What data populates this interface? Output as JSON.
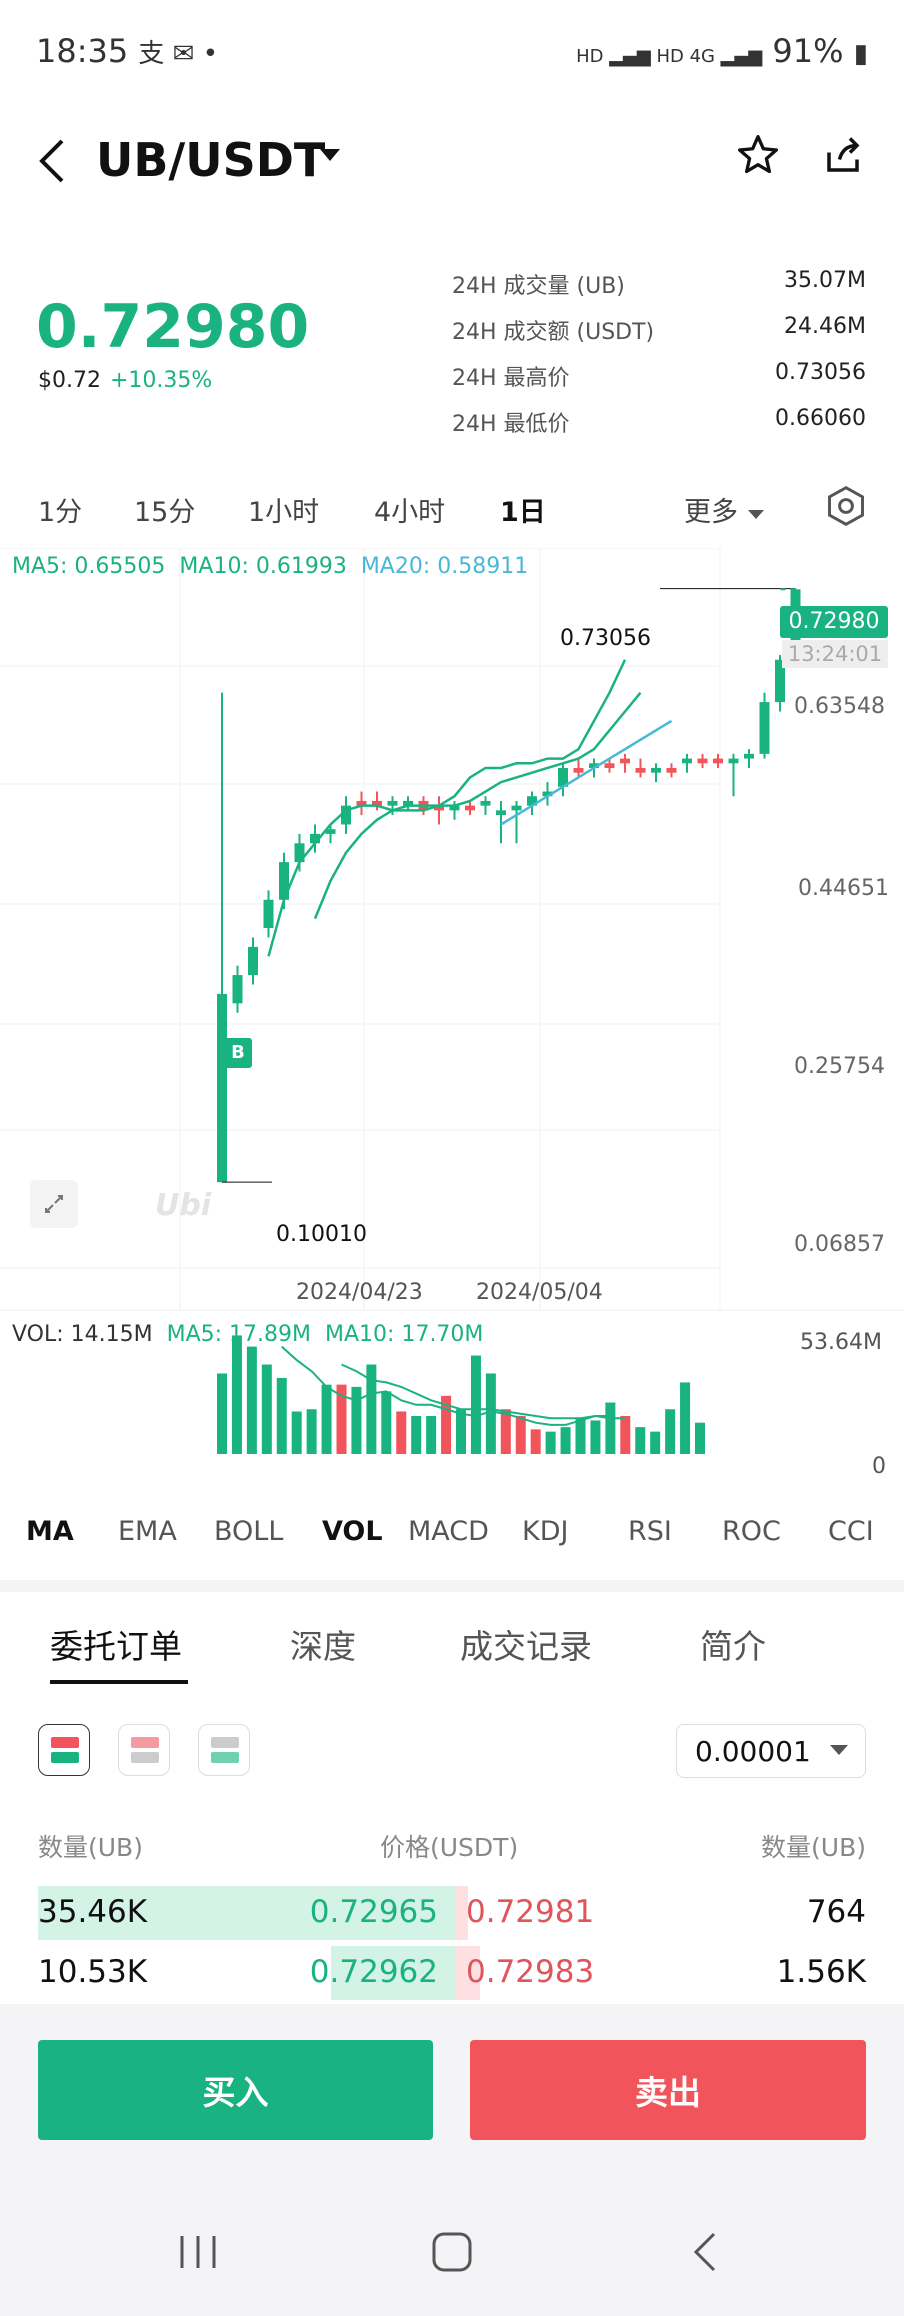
{
  "status": {
    "time": "18:35",
    "app_icons": "支 ✉ •",
    "signal": "HD ▂▄▆ HD 4G ▂▄▆",
    "battery": "91%"
  },
  "header": {
    "pair": "UB/USDT"
  },
  "ticker": {
    "price": "0.72980",
    "usd": "$0.72",
    "change": "+10.35%"
  },
  "stats": [
    {
      "label": "24H 成交量 (UB)",
      "value": "35.07M"
    },
    {
      "label": "24H 成交额 (USDT)",
      "value": "24.46M"
    },
    {
      "label": "24H 最高价",
      "value": "0.73056"
    },
    {
      "label": "24H 最低价",
      "value": "0.66060"
    }
  ],
  "intervals": [
    "1分",
    "15分",
    "1小时",
    "4小时",
    "1日"
  ],
  "more_label": "更多",
  "chart": {
    "ma_legend": {
      "ma5": "MA5: 0.65505",
      "ma10": "MA10: 0.61993",
      "ma20": "MA20: 0.58911"
    },
    "price_labels": [
      "0.63548",
      "0.44651",
      "0.25754",
      "0.06857"
    ],
    "current_price": "0.72980",
    "countdown": "13:24:01",
    "high_label": "0.73056",
    "low_label": "0.10010",
    "dates": [
      "2024/04/23",
      "2024/05/04"
    ],
    "vol_legend": {
      "vol": "VOL: 14.15M",
      "ma5": "MA5: 17.89M",
      "ma10": "MA10: 17.70M"
    },
    "vol_labels": [
      "53.64M",
      "0"
    ],
    "watermark": "Ubi",
    "buy_marker": "B"
  },
  "indicators": [
    "MA",
    "EMA",
    "BOLL",
    "VOL",
    "MACD",
    "KDJ",
    "RSI",
    "ROC",
    "CCI"
  ],
  "sections": [
    "委托订单",
    "深度",
    "成交记录",
    "简介"
  ],
  "orderbook": {
    "precision": "0.00001",
    "headers": {
      "left": "数量(UB)",
      "mid": "价格(USDT)",
      "right": "数量(UB)"
    },
    "rows": [
      {
        "bid_qty": "35.46K",
        "bid_price": "0.72965",
        "ask_price": "0.72981",
        "ask_qty": "764",
        "bid_fill": 1.0,
        "ask_fill": 0.03
      },
      {
        "bid_qty": "10.53K",
        "bid_price": "0.72962",
        "ask_price": "0.72983",
        "ask_qty": "1.56K",
        "bid_fill": 0.3,
        "ask_fill": 0.06
      }
    ]
  },
  "actions": {
    "buy": "买入",
    "sell": "卖出"
  },
  "colors": {
    "up": "#19b281",
    "down": "#f2545b",
    "ma10": "#1bb281",
    "ma20": "#49b8d8"
  },
  "chart_data": {
    "type": "candlestick",
    "x_labels": [
      "2024/04/23",
      "2024/05/04"
    ],
    "y_ticks": [
      0.63548,
      0.44651,
      0.25754,
      0.06857
    ],
    "ylim": [
      0.06857,
      0.76
    ],
    "candles": [
      {
        "o": 0.3,
        "h": 0.62,
        "l": 0.1001,
        "c": 0.1,
        "up": true
      },
      {
        "o": 0.29,
        "h": 0.33,
        "l": 0.28,
        "c": 0.32,
        "up": true
      },
      {
        "o": 0.32,
        "h": 0.36,
        "l": 0.31,
        "c": 0.35,
        "up": true
      },
      {
        "o": 0.37,
        "h": 0.41,
        "l": 0.36,
        "c": 0.4,
        "up": true
      },
      {
        "o": 0.4,
        "h": 0.45,
        "l": 0.39,
        "c": 0.44,
        "up": true
      },
      {
        "o": 0.44,
        "h": 0.47,
        "l": 0.43,
        "c": 0.46,
        "up": true
      },
      {
        "o": 0.46,
        "h": 0.48,
        "l": 0.45,
        "c": 0.47,
        "up": true
      },
      {
        "o": 0.47,
        "h": 0.48,
        "l": 0.46,
        "c": 0.475,
        "up": true
      },
      {
        "o": 0.48,
        "h": 0.51,
        "l": 0.47,
        "c": 0.5,
        "up": true
      },
      {
        "o": 0.5,
        "h": 0.515,
        "l": 0.49,
        "c": 0.505,
        "up": false
      },
      {
        "o": 0.505,
        "h": 0.515,
        "l": 0.495,
        "c": 0.5,
        "up": false
      },
      {
        "o": 0.5,
        "h": 0.51,
        "l": 0.49,
        "c": 0.505,
        "up": true
      },
      {
        "o": 0.505,
        "h": 0.51,
        "l": 0.495,
        "c": 0.5,
        "up": true
      },
      {
        "o": 0.505,
        "h": 0.51,
        "l": 0.49,
        "c": 0.495,
        "up": false
      },
      {
        "o": 0.5,
        "h": 0.51,
        "l": 0.48,
        "c": 0.495,
        "up": false
      },
      {
        "o": 0.495,
        "h": 0.505,
        "l": 0.485,
        "c": 0.5,
        "up": true
      },
      {
        "o": 0.5,
        "h": 0.505,
        "l": 0.49,
        "c": 0.495,
        "up": false
      },
      {
        "o": 0.5,
        "h": 0.51,
        "l": 0.49,
        "c": 0.505,
        "up": true
      },
      {
        "o": 0.495,
        "h": 0.505,
        "l": 0.46,
        "c": 0.49,
        "up": true
      },
      {
        "o": 0.495,
        "h": 0.505,
        "l": 0.46,
        "c": 0.5,
        "up": true
      },
      {
        "o": 0.5,
        "h": 0.515,
        "l": 0.49,
        "c": 0.51,
        "up": true
      },
      {
        "o": 0.51,
        "h": 0.525,
        "l": 0.5,
        "c": 0.515,
        "up": true
      },
      {
        "o": 0.52,
        "h": 0.545,
        "l": 0.51,
        "c": 0.54,
        "up": true
      },
      {
        "o": 0.54,
        "h": 0.55,
        "l": 0.53,
        "c": 0.535,
        "up": false
      },
      {
        "o": 0.54,
        "h": 0.55,
        "l": 0.53,
        "c": 0.545,
        "up": true
      },
      {
        "o": 0.545,
        "h": 0.55,
        "l": 0.535,
        "c": 0.54,
        "up": false
      },
      {
        "o": 0.545,
        "h": 0.555,
        "l": 0.535,
        "c": 0.55,
        "up": false
      },
      {
        "o": 0.54,
        "h": 0.55,
        "l": 0.53,
        "c": 0.535,
        "up": false
      },
      {
        "o": 0.535,
        "h": 0.545,
        "l": 0.525,
        "c": 0.54,
        "up": true
      },
      {
        "o": 0.54,
        "h": 0.545,
        "l": 0.53,
        "c": 0.535,
        "up": false
      },
      {
        "o": 0.545,
        "h": 0.555,
        "l": 0.535,
        "c": 0.55,
        "up": true
      },
      {
        "o": 0.55,
        "h": 0.555,
        "l": 0.54,
        "c": 0.545,
        "up": false
      },
      {
        "o": 0.55,
        "h": 0.555,
        "l": 0.54,
        "c": 0.545,
        "up": false
      },
      {
        "o": 0.545,
        "h": 0.555,
        "l": 0.51,
        "c": 0.55,
        "up": true
      },
      {
        "o": 0.55,
        "h": 0.56,
        "l": 0.54,
        "c": 0.555,
        "up": true
      },
      {
        "o": 0.555,
        "h": 0.62,
        "l": 0.55,
        "c": 0.61,
        "up": true
      },
      {
        "o": 0.61,
        "h": 0.66,
        "l": 0.6,
        "c": 0.655,
        "up": true
      },
      {
        "o": 0.66,
        "h": 0.73056,
        "l": 0.65,
        "c": 0.7298,
        "up": true
      }
    ],
    "ma5": [
      0.34,
      0.4,
      0.44,
      0.46,
      0.48,
      0.495,
      0.5,
      0.5,
      0.495,
      0.495,
      0.495,
      0.5,
      0.51,
      0.53,
      0.54,
      0.54,
      0.545,
      0.545,
      0.55,
      0.55,
      0.56,
      0.59,
      0.62,
      0.655
    ],
    "ma10": [
      0.38,
      0.42,
      0.45,
      0.47,
      0.485,
      0.495,
      0.5,
      0.5,
      0.5,
      0.5,
      0.505,
      0.515,
      0.525,
      0.53,
      0.535,
      0.54,
      0.545,
      0.55,
      0.56,
      0.58,
      0.6,
      0.62
    ],
    "ma20": [
      0.48,
      0.49,
      0.5,
      0.51,
      0.52,
      0.53,
      0.54,
      0.55,
      0.56,
      0.57,
      0.58,
      0.59
    ],
    "volume": [
      {
        "v": 36,
        "up": true
      },
      {
        "v": 53,
        "up": true
      },
      {
        "v": 48,
        "up": true
      },
      {
        "v": 40,
        "up": true
      },
      {
        "v": 34,
        "up": true
      },
      {
        "v": 19,
        "up": true
      },
      {
        "v": 20,
        "up": true
      },
      {
        "v": 31,
        "up": true
      },
      {
        "v": 31,
        "up": false
      },
      {
        "v": 30,
        "up": true
      },
      {
        "v": 40,
        "up": true
      },
      {
        "v": 28,
        "up": true
      },
      {
        "v": 19,
        "up": false
      },
      {
        "v": 17,
        "up": true
      },
      {
        "v": 17,
        "up": true
      },
      {
        "v": 26,
        "up": false
      },
      {
        "v": 20,
        "up": true
      },
      {
        "v": 44,
        "up": true
      },
      {
        "v": 36,
        "up": true
      },
      {
        "v": 20,
        "up": false
      },
      {
        "v": 17,
        "up": false
      },
      {
        "v": 11,
        "up": false
      },
      {
        "v": 10,
        "up": true
      },
      {
        "v": 12,
        "up": true
      },
      {
        "v": 16,
        "up": true
      },
      {
        "v": 15,
        "up": true
      },
      {
        "v": 23,
        "up": true
      },
      {
        "v": 17,
        "up": false
      },
      {
        "v": 12,
        "up": true
      },
      {
        "v": 10,
        "up": true
      },
      {
        "v": 20,
        "up": true
      },
      {
        "v": 32,
        "up": true
      },
      {
        "v": 14,
        "up": true
      }
    ],
    "vol_ylim": [
      0,
      53.64
    ]
  }
}
